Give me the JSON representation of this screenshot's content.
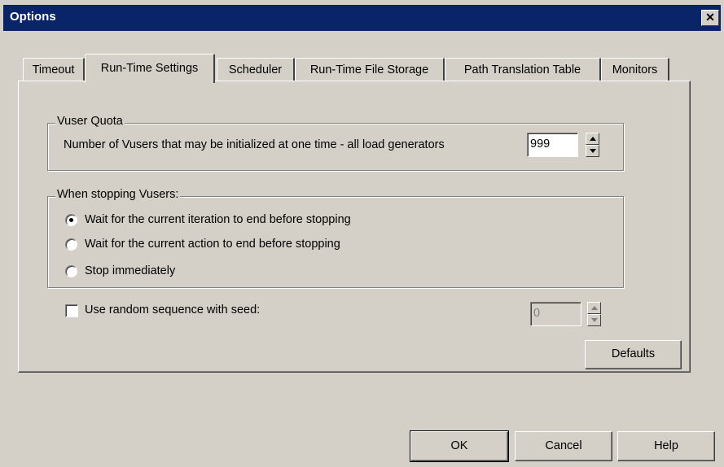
{
  "window": {
    "title": "Options",
    "close_glyph": "✕"
  },
  "tabs": [
    {
      "label": "Timeout"
    },
    {
      "label": "Run-Time Settings",
      "active": true
    },
    {
      "label": "Scheduler"
    },
    {
      "label": "Run-Time File Storage"
    },
    {
      "label": "Path Translation Table"
    },
    {
      "label": "Monitors"
    }
  ],
  "vuser_quota": {
    "legend": "Vuser Quota",
    "label": "Number of Vusers that may be initialized at one time - all load generators",
    "value": "999"
  },
  "stopping": {
    "legend": "When stopping Vusers:",
    "options": [
      {
        "label": "Wait for the current iteration to end before stopping",
        "selected": true
      },
      {
        "label": "Wait for the current action to end before stopping",
        "selected": false
      },
      {
        "label": "Stop immediately",
        "selected": false
      }
    ]
  },
  "random_seed": {
    "label": "Use random sequence with seed:",
    "checked": false,
    "value": "0"
  },
  "buttons": {
    "defaults": "Defaults",
    "ok": "OK",
    "cancel": "Cancel",
    "help": "Help"
  },
  "icons": {
    "spin_up": "spin-up-arrow",
    "spin_down": "spin-down-arrow",
    "close": "close-icon"
  }
}
